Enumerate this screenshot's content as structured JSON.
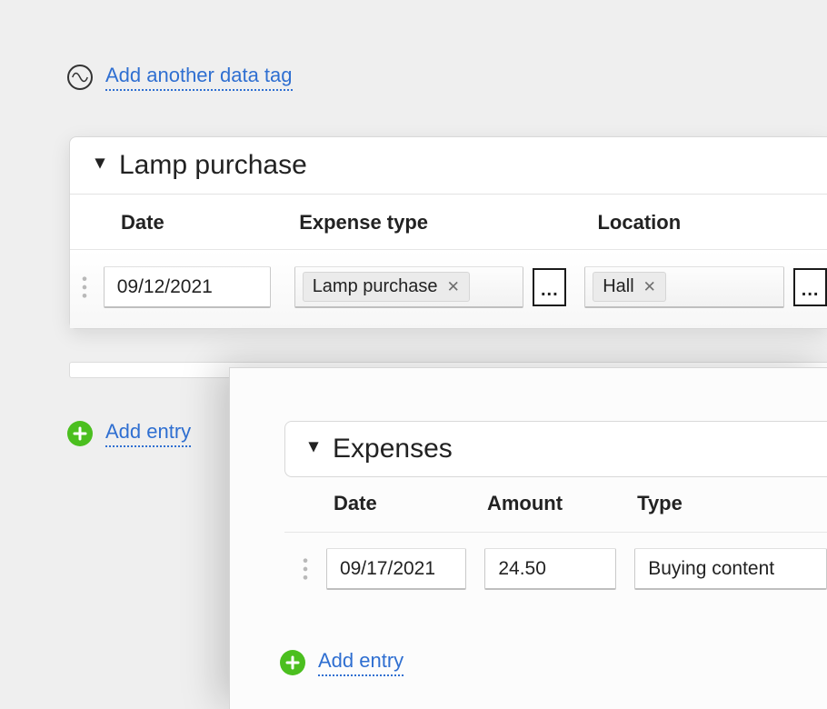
{
  "topLink": {
    "label": "Add another data tag"
  },
  "card1": {
    "title": "Lamp purchase",
    "columns": {
      "date": "Date",
      "expenseType": "Expense type",
      "location": "Location"
    },
    "row": {
      "date": "09/12/2021",
      "expenseTag": "Lamp purchase",
      "locationTag": "Hall",
      "ellipsis": "..."
    }
  },
  "addEntry1": {
    "label": "Add entry"
  },
  "card2": {
    "title": "Expenses",
    "columns": {
      "date": "Date",
      "amount": "Amount",
      "type": "Type"
    },
    "row": {
      "date": "09/17/2021",
      "amount": "24.50",
      "type": "Buying content"
    }
  },
  "addEntry2": {
    "label": "Add entry"
  }
}
